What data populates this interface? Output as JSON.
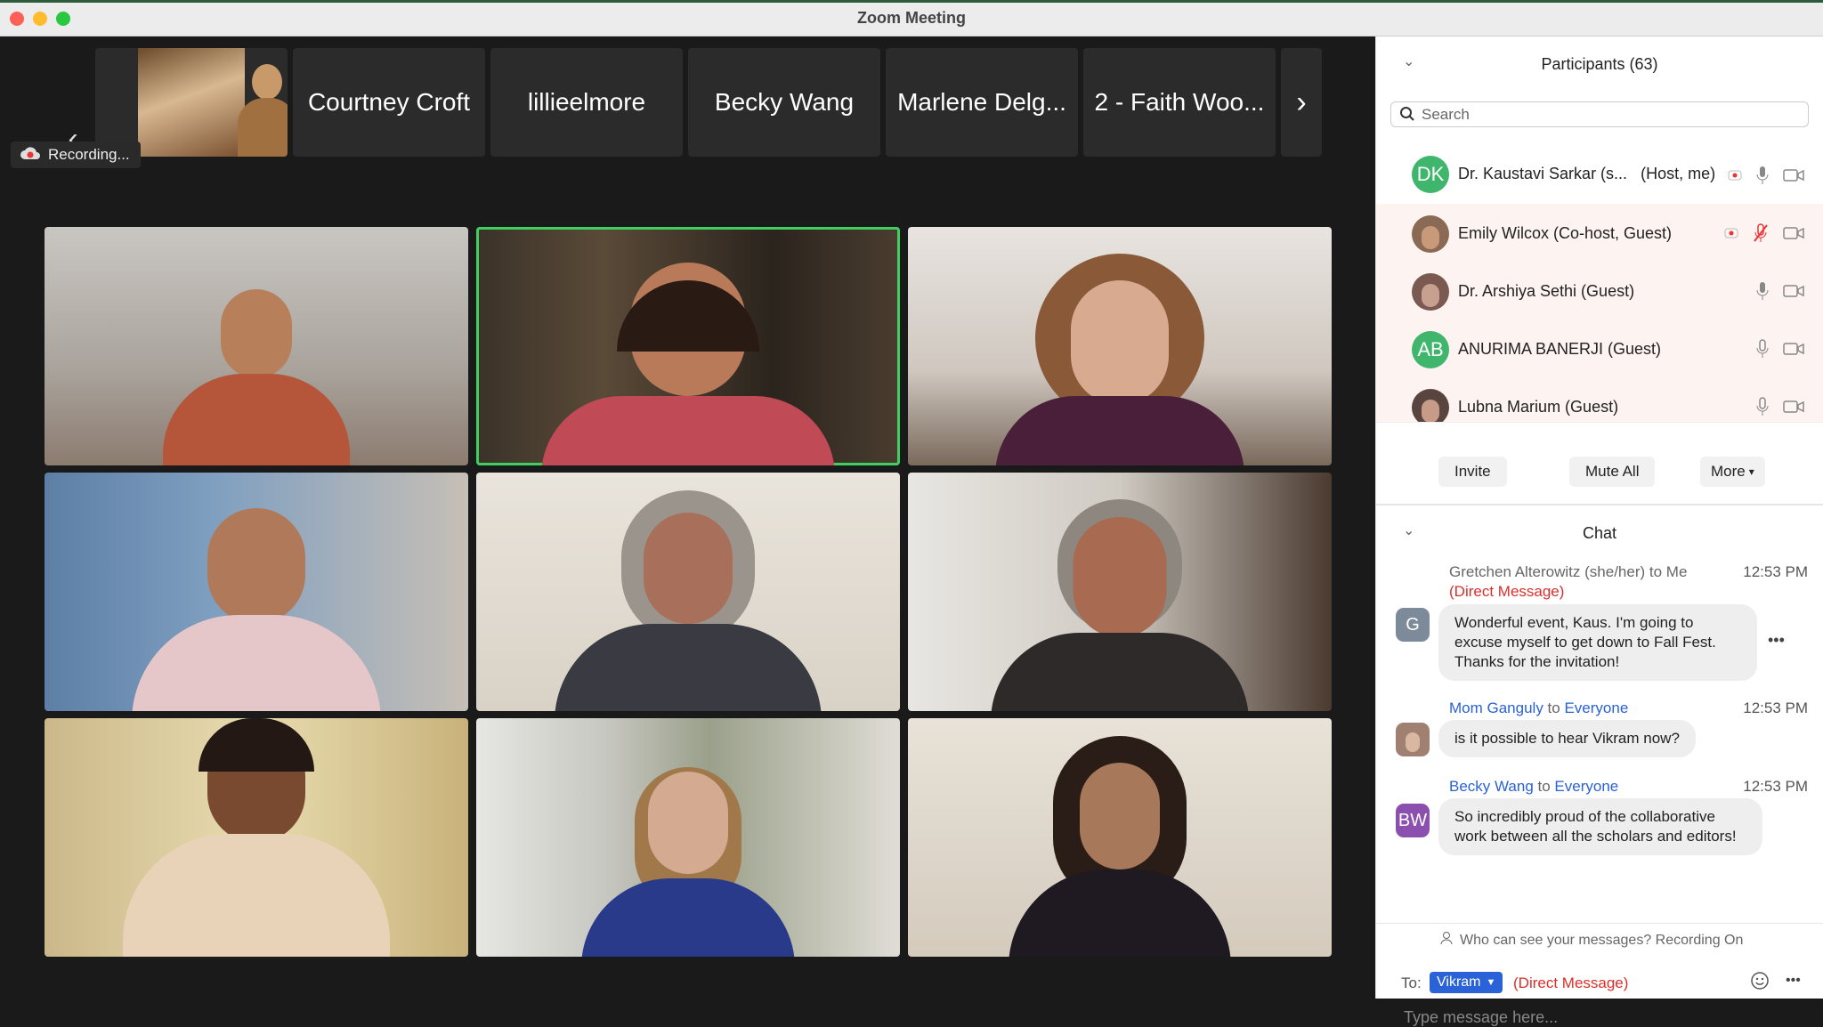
{
  "window": {
    "title": "Zoom Meeting"
  },
  "strip": {
    "tiles": [
      "Courtney Croft",
      "lillieelmore",
      "Becky Wang",
      "Marlene Delg...",
      "2 - Faith Woo..."
    ]
  },
  "recording": {
    "label": "Recording..."
  },
  "participants": {
    "header": "Participants (63)",
    "search_placeholder": "Search",
    "rows": [
      {
        "initials": "DK",
        "name": "Dr. Kaustavi Sarkar (s...",
        "role": "(Host, me)",
        "avatar_color": "#3fb66b"
      },
      {
        "initials": "",
        "name": "Emily Wilcox (Co-host, Guest)",
        "role": "",
        "avatar_color": "#8a6a55"
      },
      {
        "initials": "",
        "name": "Dr. Arshiya Sethi (Guest)",
        "role": "",
        "avatar_color": "#7a5a50"
      },
      {
        "initials": "AB",
        "name": "ANURIMA BANERJI (Guest)",
        "role": "",
        "avatar_color": "#3fb66b"
      },
      {
        "initials": "",
        "name": "Lubna Marium (Guest)",
        "role": "",
        "avatar_color": "#5a4440"
      }
    ],
    "buttons": {
      "invite": "Invite",
      "mute_all": "Mute All",
      "more": "More"
    }
  },
  "chat": {
    "header": "Chat",
    "messages": [
      {
        "avatar": "G",
        "avatar_color": "#7d8a9a",
        "sender": "Gretchen Alterowitz (she/her)",
        "to_word": " to ",
        "recipient": "Me",
        "tag": "(Direct Message)",
        "time": "12:53 PM",
        "text": "Wonderful event, Kaus. I'm going to excuse myself to get down to Fall Fest. Thanks for the invitation!"
      },
      {
        "avatar": "",
        "avatar_color": "#a08070",
        "sender": "Mom Ganguly",
        "to_word": " to ",
        "recipient": "Everyone",
        "tag": "",
        "time": "12:53 PM",
        "text": "is it possible to hear Vikram now?"
      },
      {
        "avatar": "BW",
        "avatar_color": "#8b4fb0",
        "sender": "Becky Wang",
        "to_word": " to ",
        "recipient": "Everyone",
        "tag": "",
        "time": "12:53 PM",
        "text": "So incredibly proud of the collaborative work between all the scholars and editors!"
      }
    ],
    "visibility_note": "Who can see your messages? Recording On",
    "to_label": "To:",
    "recipient_select": "Vikram",
    "recipient_tag": "(Direct Message)",
    "input_placeholder": "Type message here..."
  },
  "colors": {
    "accent_blue": "#2a62d8",
    "direct_red": "#d9302c",
    "active_green": "#3fcf5f"
  }
}
